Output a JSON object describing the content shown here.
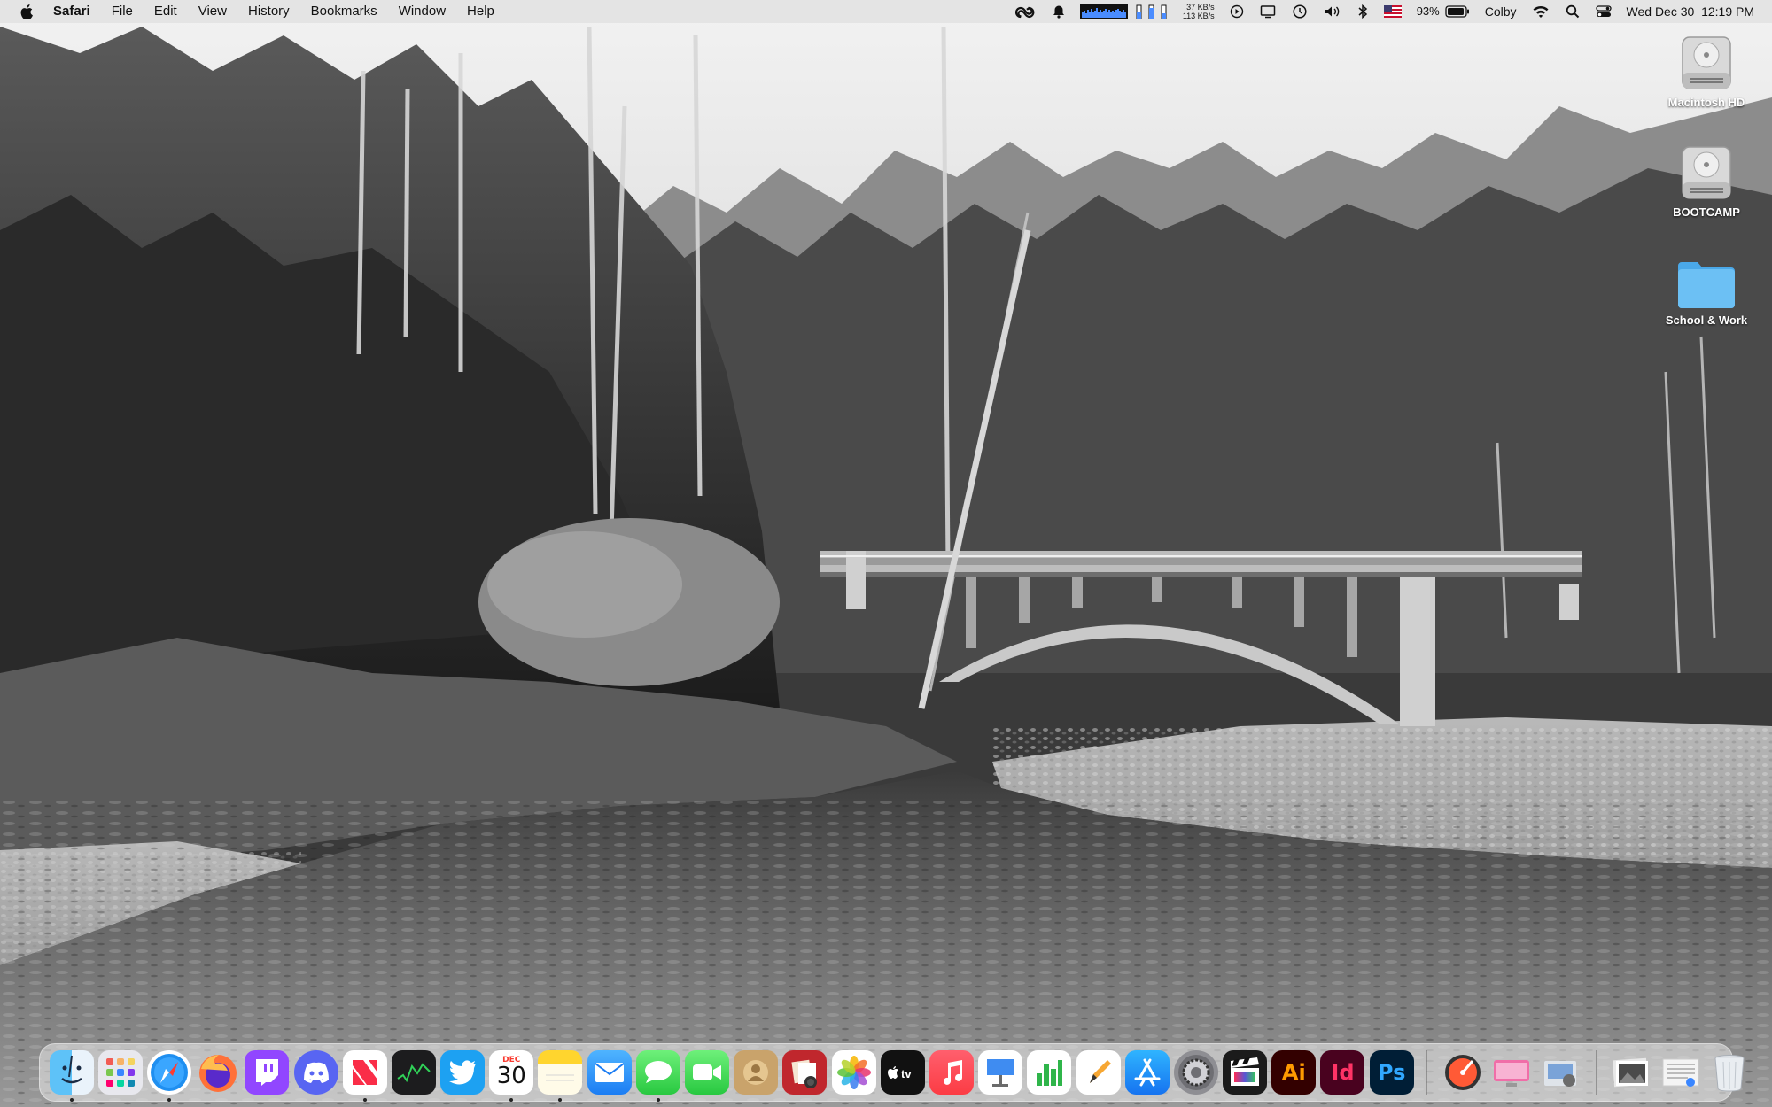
{
  "menubar": {
    "app_name": "Safari",
    "menus": [
      "File",
      "Edit",
      "View",
      "History",
      "Bookmarks",
      "Window",
      "Help"
    ],
    "net_up": "37 KB/s",
    "net_down": "113 KB/s",
    "battery_percent": "93%",
    "user": "Colby",
    "datetime": "Wed Dec 30  12:19 PM"
  },
  "desktop": {
    "icons": [
      {
        "label": "Macintosh HD",
        "icon": "hard-drive-icon"
      },
      {
        "label": "BOOTCAMP",
        "icon": "hard-drive-icon"
      },
      {
        "label": "School & Work",
        "icon": "folder-icon"
      }
    ]
  },
  "dock": {
    "calendar_month": "DEC",
    "calendar_day": "30",
    "apps": [
      {
        "name": "finder",
        "running": true
      },
      {
        "name": "launchpad",
        "running": false
      },
      {
        "name": "safari",
        "running": true
      },
      {
        "name": "firefox",
        "running": false
      },
      {
        "name": "twitch",
        "running": false
      },
      {
        "name": "discord",
        "running": false
      },
      {
        "name": "news",
        "running": true
      },
      {
        "name": "stocks",
        "running": false
      },
      {
        "name": "twitter",
        "running": false
      },
      {
        "name": "calendar",
        "running": true
      },
      {
        "name": "notes",
        "running": true
      },
      {
        "name": "mail",
        "running": false
      },
      {
        "name": "messages",
        "running": true
      },
      {
        "name": "facetime",
        "running": false
      },
      {
        "name": "contacts",
        "running": false
      },
      {
        "name": "photo-booth",
        "running": false
      },
      {
        "name": "photos",
        "running": false
      },
      {
        "name": "apple-tv",
        "running": false
      },
      {
        "name": "music",
        "running": false
      },
      {
        "name": "keynote",
        "running": false
      },
      {
        "name": "numbers",
        "running": false
      },
      {
        "name": "pages",
        "running": false
      },
      {
        "name": "app-store",
        "running": false
      },
      {
        "name": "system-preferences",
        "running": false
      },
      {
        "name": "final-cut-pro",
        "running": false
      },
      {
        "name": "illustrator",
        "label": "Ai",
        "running": false
      },
      {
        "name": "indesign",
        "label": "Id",
        "running": false
      },
      {
        "name": "photoshop",
        "label": "Ps",
        "running": false
      }
    ],
    "right_apps": [
      "instruments",
      "pink-display",
      "preview-tools",
      "photos-stack",
      "documents-stack",
      "trash"
    ]
  },
  "colors": {
    "menubar_bg": "#e1e1e1",
    "folder_blue": "#5fb6f0",
    "illustrator": "#330000",
    "illustrator_text": "#ff9a00",
    "indesign": "#49021f",
    "indesign_text": "#ff3366",
    "photoshop": "#001e36",
    "photoshop_text": "#31a8ff"
  }
}
